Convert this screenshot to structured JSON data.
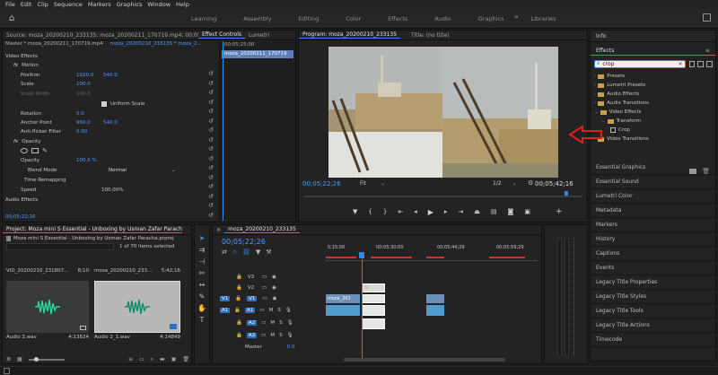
{
  "menu": [
    "File",
    "Edit",
    "Clip",
    "Sequence",
    "Markers",
    "Graphics",
    "Window",
    "Help"
  ],
  "workspaces": [
    "Learning",
    "Assembly",
    "Editing",
    "Color",
    "Effects",
    "Audio",
    "Graphics",
    "Libraries"
  ],
  "effect_controls": {
    "tabs": [
      "Source: moza_20200210_233135: moza_20200211_170719.mp4: 00;05;22;26",
      "Effect Controls",
      "Lumetri"
    ],
    "master": "Master * moza_20200211_170719.mp4",
    "clip": "moza_20200210_233135 * moza_2...",
    "mini_timecode": ";00;05;25;00",
    "mini_clip": "moza_20200211_170719",
    "section_video": "Video Effects",
    "motion": "Motion",
    "position_label": "Position",
    "position_x": "1920.0",
    "position_y": "540.0",
    "scale_label": "Scale",
    "scale_value": "100.0",
    "scale_width_label": "Scale Width",
    "scale_width_value": "100.0",
    "uniform_scale": "Uniform Scale",
    "rotation_label": "Rotation",
    "rotation_value": "0.0",
    "anchor_label": "Anchor Point",
    "anchor_x": "960.0",
    "anchor_y": "540.0",
    "antiflicker_label": "Anti-flicker Filter",
    "antiflicker_value": "0.00",
    "opacity": "Opacity",
    "opacity_label": "Opacity",
    "opacity_value": "100.0 %",
    "blend_label": "Blend Mode",
    "blend_value": "Normal",
    "time_remap": "Time Remapping",
    "speed_label": "Speed",
    "speed_value": "100.00%",
    "audio_effects": "Audio Effects",
    "bottom_timecode": "00;05;22;26"
  },
  "program": {
    "tabs": [
      "Program: moza_20200210_233135",
      "Title: (no title)"
    ],
    "timecode": "00;05;22;26",
    "fit": "Fit",
    "ratio": "1/2",
    "duration": "00;05;42;16"
  },
  "project": {
    "tab": "Project: Moza mini S Essential - Unboxing by Usman Zafar Paracha",
    "file": "Moza mini S Essential - Unboxing by Usman Zafar Paracha.prproj",
    "selection": "1 of 70 items selected",
    "items": [
      {
        "name": "VID_20200210_231807...",
        "time": "8;10",
        "audio": "Audio 2.wav",
        "audio_time": "4:13824"
      },
      {
        "name": "moza_20200210_233...",
        "time": "5;42;16",
        "audio": "Audio 2_1.wav",
        "audio_time": "4:14849"
      }
    ]
  },
  "timeline": {
    "tab": "moza_20200210_233135",
    "timecode": "00;05;22;26",
    "ruler": [
      "5;15;00",
      "00;05;30;00",
      "00;05;44;29",
      "00;05;59;29"
    ],
    "video_tracks": [
      "V3",
      "V2",
      "V1"
    ],
    "audio_tracks": [
      "A1",
      "A2",
      "A3"
    ],
    "src_v": "V1",
    "src_a": "A1",
    "master": "Master",
    "master_val": "0.0",
    "clip_moza": "moza_202",
    "clip_fx": "fx"
  },
  "right_panel": {
    "info": "Info",
    "effects_title": "Effects",
    "search_value": "crop",
    "tree": [
      {
        "label": "Presets",
        "level": 0,
        "icon": "folder"
      },
      {
        "label": "Lumetri Presets",
        "level": 0,
        "icon": "folder"
      },
      {
        "label": "Audio Effects",
        "level": 0,
        "icon": "folder"
      },
      {
        "label": "Audio Transitions",
        "level": 0,
        "icon": "folder"
      },
      {
        "label": "Video Effects",
        "level": 0,
        "icon": "folder",
        "open": true
      },
      {
        "label": "Transform",
        "level": 1,
        "icon": "folder",
        "open": true
      },
      {
        "label": "Crop",
        "level": 2,
        "icon": "effect"
      },
      {
        "label": "Video Transitions",
        "level": 0,
        "icon": "folder"
      }
    ],
    "panels": [
      "Essential Graphics",
      "Essential Sound",
      "Lumetri Color",
      "Metadata",
      "Markers",
      "History",
      "Captions",
      "Events",
      "Legacy Title Properties",
      "Legacy Title Styles",
      "Legacy Title Tools",
      "Legacy Title Actions",
      "Timecode"
    ]
  },
  "colors": {
    "accent": "#2d8ceb",
    "arrow": "#e02020",
    "video_clip": "#6b8fb6",
    "audio_clip": "#4f9cd0"
  }
}
